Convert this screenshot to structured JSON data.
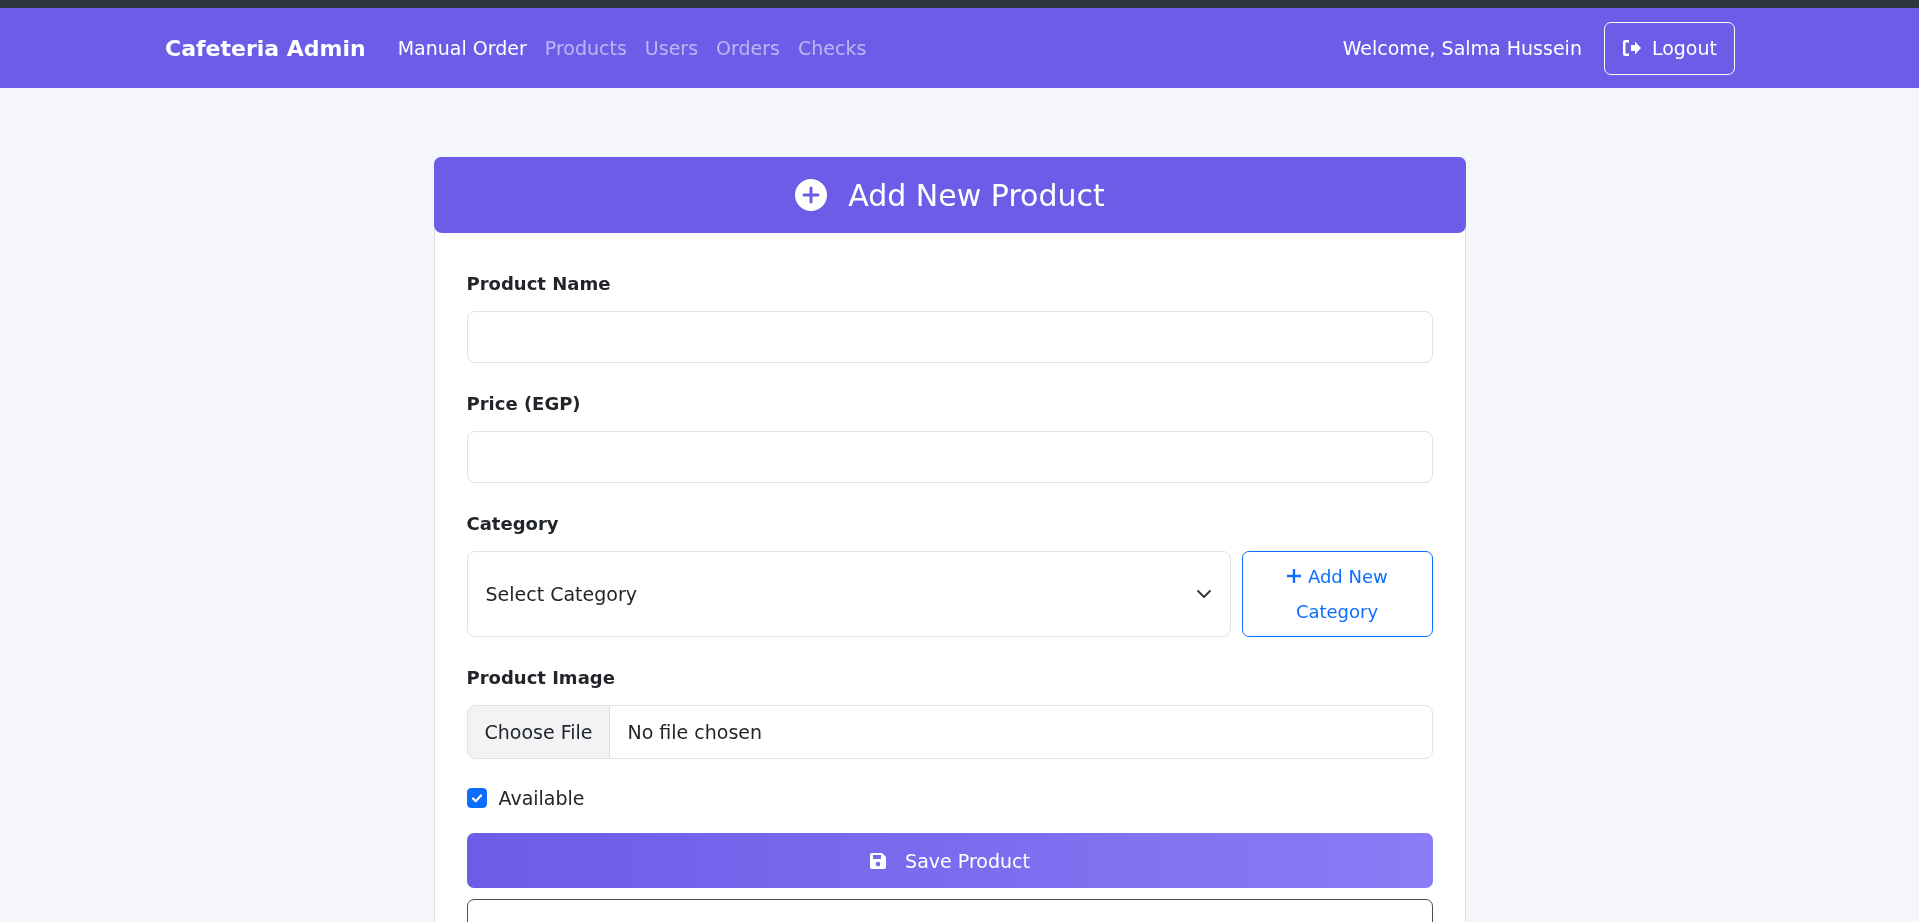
{
  "navbar": {
    "brand": "Cafeteria Admin",
    "links": [
      {
        "label": "Manual Order",
        "selected": true
      },
      {
        "label": "Products",
        "selected": false
      },
      {
        "label": "Users",
        "selected": false
      },
      {
        "label": "Orders",
        "selected": false
      },
      {
        "label": "Checks",
        "selected": false
      }
    ],
    "welcome": "Welcome, Salma Hussein",
    "logout": "Logout"
  },
  "card": {
    "title": "Add New Product",
    "fields": [
      {
        "kind": "text",
        "label": "Product Name"
      },
      {
        "kind": "text",
        "label": "Price (EGP)"
      },
      {
        "kind": "select",
        "label": "Category",
        "value": "Select Category",
        "button": "Add New Category"
      },
      {
        "kind": "file",
        "label": "Product Image",
        "button": "Choose File",
        "value": "No file chosen"
      },
      {
        "kind": "checkbox",
        "label": "Available",
        "checked": true
      }
    ],
    "submit": "Save Product"
  }
}
